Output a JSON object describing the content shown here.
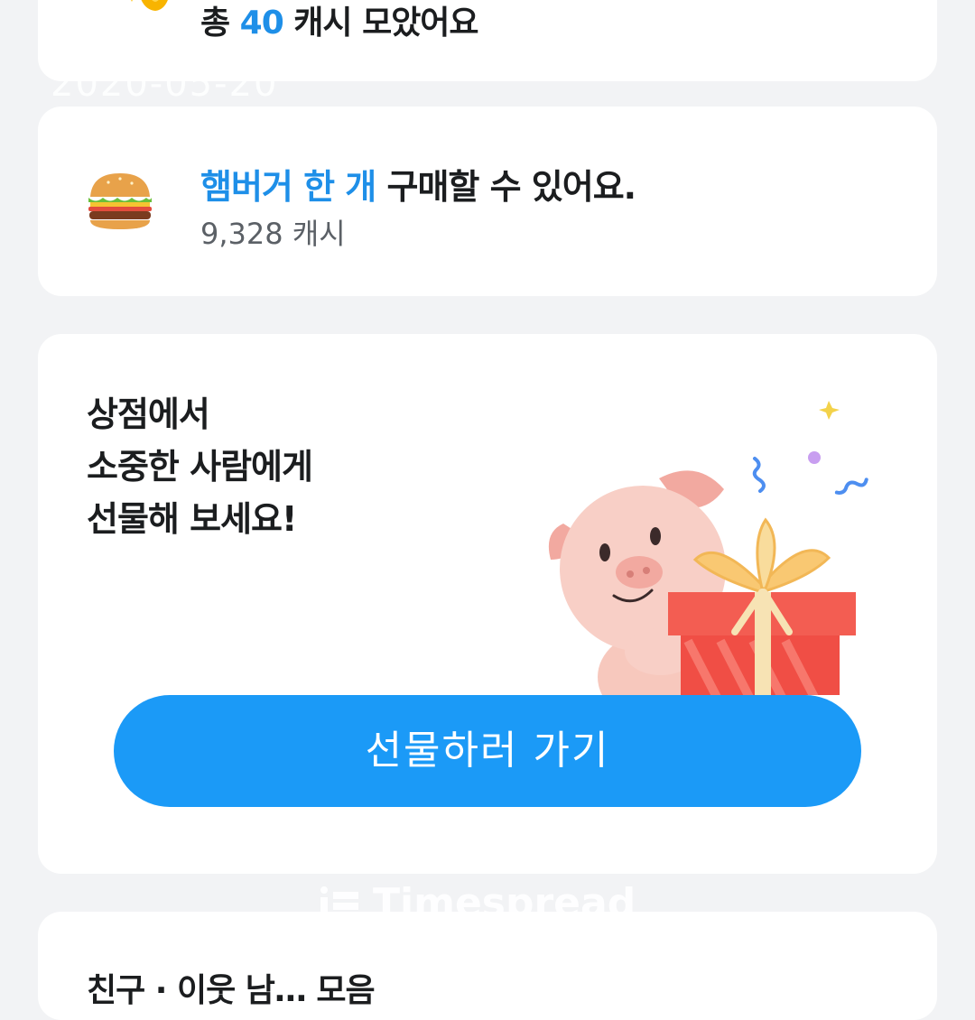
{
  "total_card": {
    "prefix": "총 ",
    "amount": "40",
    "suffix": " 캐시 모았어요",
    "coin_icon": "coin-sparkle-icon"
  },
  "date_watermark": "2020-05-20",
  "burger_card": {
    "highlight": "햄버거 한 개",
    "text": " 구매할 수 있어요.",
    "cash": "9,328 캐시",
    "icon": "hamburger-icon"
  },
  "gift_card": {
    "lines": [
      "상점에서",
      "소중한 사람에게",
      "선물해 보세요!"
    ],
    "button_label": "선물하러 가기",
    "illustration": "pig-with-gift-icon"
  },
  "brand_watermark": "Timespread",
  "bottom_card": {
    "title": "친구 · 이웃 남… 모음"
  },
  "colors": {
    "accent": "#1e8fe8",
    "button": "#1b9af7",
    "background": "#f2f3f5"
  }
}
